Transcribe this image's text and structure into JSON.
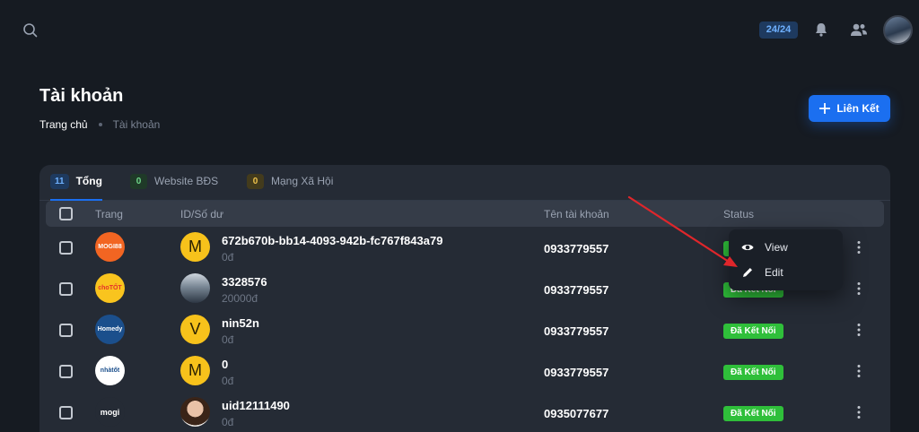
{
  "header": {
    "search_icon": "search-icon",
    "quota": "24/24",
    "bell_icon": "bell-icon",
    "users_icon": "users-icon"
  },
  "page": {
    "title": "Tài khoản",
    "breadcrumb": {
      "home": "Trang chủ",
      "current": "Tài khoản"
    },
    "add_button": "Liên Kết"
  },
  "tabs": [
    {
      "count": "11",
      "label": "Tổng",
      "active": true
    },
    {
      "count": "0",
      "label": "Website BĐS",
      "active": false
    },
    {
      "count": "0",
      "label": "Mạng Xã Hội",
      "active": false
    }
  ],
  "table": {
    "columns": {
      "page": "Trang",
      "id_balance": "ID/Số dư",
      "account_name": "Tên tài khoản",
      "status": "Status"
    },
    "rows": [
      {
        "logo_text": "MOGI88",
        "logo_color": "#f26522",
        "avatar_letter": "M",
        "id": "672b670b-bb14-4093-942b-fc767f843a79",
        "balance": "0đ",
        "account_name": "0933779557",
        "status": ""
      },
      {
        "logo_text": "choTỐT",
        "logo_color": "#f9c41e",
        "avatar_letter": "",
        "id": "3328576",
        "balance": "20000đ",
        "account_name": "0933779557",
        "status": "Đã Kết Nối"
      },
      {
        "logo_text": "Homedy",
        "logo_color": "#1b4f8c",
        "avatar_letter": "V",
        "id": "nin52n",
        "balance": "0đ",
        "account_name": "0933779557",
        "status": "Đã Kết Nối"
      },
      {
        "logo_text": "nhàtốt",
        "logo_color": "#ffffff",
        "avatar_letter": "M",
        "id": "0",
        "balance": "0đ",
        "account_name": "0933779557",
        "status": "Đã Kết Nối"
      },
      {
        "logo_text": "mogi",
        "logo_color": "#252b35",
        "avatar_letter": "",
        "id": "uid12111490",
        "balance": "0đ",
        "account_name": "0935077677",
        "status": "Đã Kết Nối"
      }
    ]
  },
  "row_menu": {
    "view": "View",
    "edit": "Edit"
  },
  "colors": {
    "accent": "#1b6ff0",
    "status_green": "#2fbf3a",
    "annotation_red": "#e0262b"
  }
}
